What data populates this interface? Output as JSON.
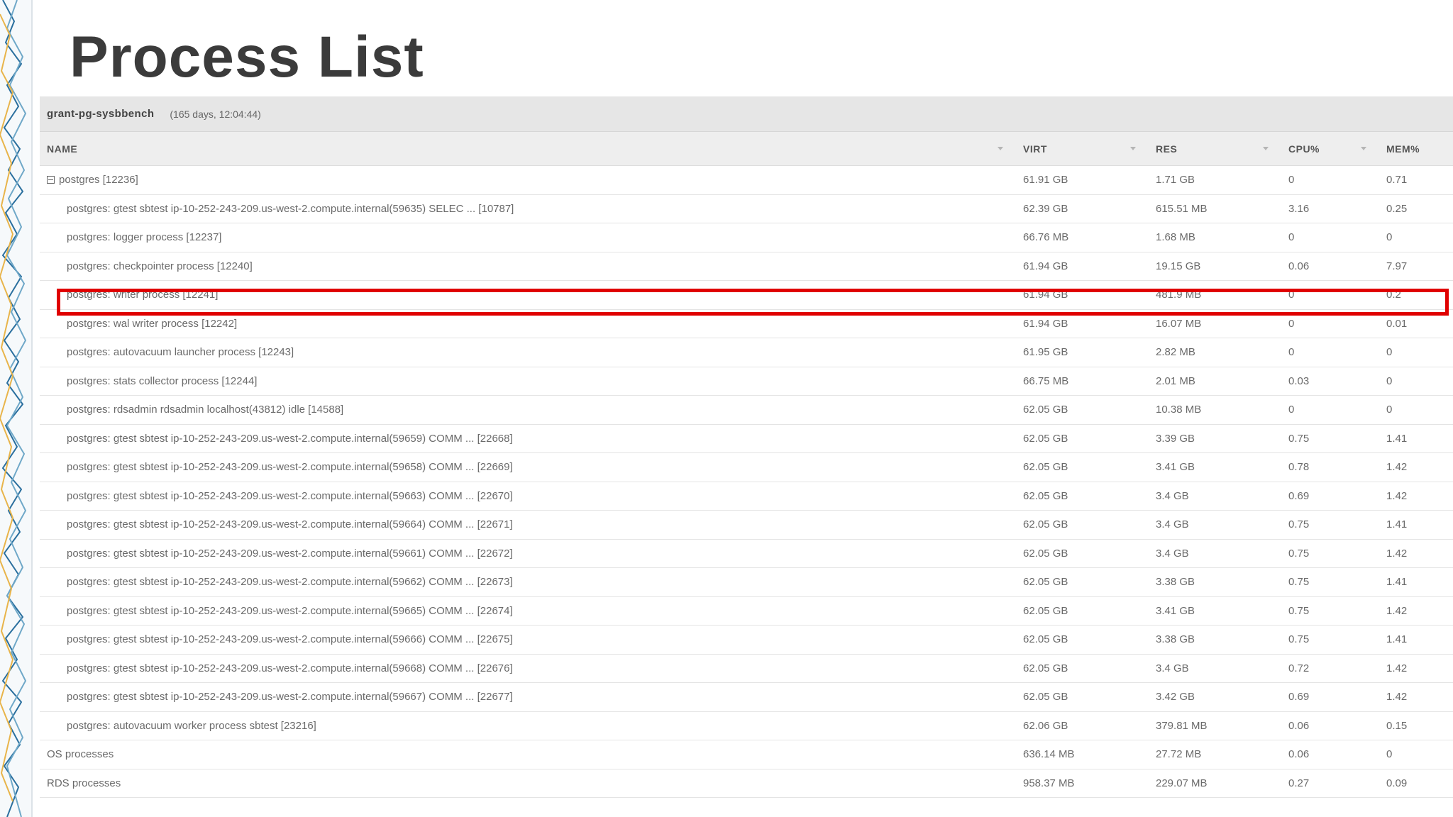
{
  "page": {
    "title": "Process List"
  },
  "server": {
    "name": "grant-pg-sysbbench",
    "uptime": "(165 days, 12:04:44)"
  },
  "columns": {
    "name": "NAME",
    "virt": "VIRT",
    "res": "RES",
    "cpu": "CPU%",
    "mem": "MEM%"
  },
  "rows": [
    {
      "name": "postgres [12236]",
      "virt": "61.91 GB",
      "res": "1.71 GB",
      "cpu": "0",
      "mem": "0.71"
    },
    {
      "name": "postgres: gtest sbtest ip-10-252-243-209.us-west-2.compute.internal(59635) SELEC ... [10787]",
      "virt": "62.39 GB",
      "res": "615.51 MB",
      "cpu": "3.16",
      "mem": "0.25"
    },
    {
      "name": "postgres: logger process [12237]",
      "virt": "66.76 MB",
      "res": "1.68 MB",
      "cpu": "0",
      "mem": "0"
    },
    {
      "name": "postgres: checkpointer process [12240]",
      "virt": "61.94 GB",
      "res": "19.15 GB",
      "cpu": "0.06",
      "mem": "7.97"
    },
    {
      "name": "postgres: writer process [12241]",
      "virt": "61.94 GB",
      "res": "481.9 MB",
      "cpu": "0",
      "mem": "0.2"
    },
    {
      "name": "postgres: wal writer process [12242]",
      "virt": "61.94 GB",
      "res": "16.07 MB",
      "cpu": "0",
      "mem": "0.01"
    },
    {
      "name": "postgres: autovacuum launcher process [12243]",
      "virt": "61.95 GB",
      "res": "2.82 MB",
      "cpu": "0",
      "mem": "0"
    },
    {
      "name": "postgres: stats collector process [12244]",
      "virt": "66.75 MB",
      "res": "2.01 MB",
      "cpu": "0.03",
      "mem": "0"
    },
    {
      "name": "postgres: rdsadmin rdsadmin localhost(43812) idle [14588]",
      "virt": "62.05 GB",
      "res": "10.38 MB",
      "cpu": "0",
      "mem": "0"
    },
    {
      "name": "postgres: gtest sbtest ip-10-252-243-209.us-west-2.compute.internal(59659) COMM ... [22668]",
      "virt": "62.05 GB",
      "res": "3.39 GB",
      "cpu": "0.75",
      "mem": "1.41"
    },
    {
      "name": "postgres: gtest sbtest ip-10-252-243-209.us-west-2.compute.internal(59658) COMM ... [22669]",
      "virt": "62.05 GB",
      "res": "3.41 GB",
      "cpu": "0.78",
      "mem": "1.42"
    },
    {
      "name": "postgres: gtest sbtest ip-10-252-243-209.us-west-2.compute.internal(59663) COMM ... [22670]",
      "virt": "62.05 GB",
      "res": "3.4 GB",
      "cpu": "0.69",
      "mem": "1.42"
    },
    {
      "name": "postgres: gtest sbtest ip-10-252-243-209.us-west-2.compute.internal(59664) COMM ... [22671]",
      "virt": "62.05 GB",
      "res": "3.4 GB",
      "cpu": "0.75",
      "mem": "1.41"
    },
    {
      "name": "postgres: gtest sbtest ip-10-252-243-209.us-west-2.compute.internal(59661) COMM ... [22672]",
      "virt": "62.05 GB",
      "res": "3.4 GB",
      "cpu": "0.75",
      "mem": "1.42"
    },
    {
      "name": "postgres: gtest sbtest ip-10-252-243-209.us-west-2.compute.internal(59662) COMM ... [22673]",
      "virt": "62.05 GB",
      "res": "3.38 GB",
      "cpu": "0.75",
      "mem": "1.41"
    },
    {
      "name": "postgres: gtest sbtest ip-10-252-243-209.us-west-2.compute.internal(59665) COMM ... [22674]",
      "virt": "62.05 GB",
      "res": "3.41 GB",
      "cpu": "0.75",
      "mem": "1.42"
    },
    {
      "name": "postgres: gtest sbtest ip-10-252-243-209.us-west-2.compute.internal(59666) COMM ... [22675]",
      "virt": "62.05 GB",
      "res": "3.38 GB",
      "cpu": "0.75",
      "mem": "1.41"
    },
    {
      "name": "postgres: gtest sbtest ip-10-252-243-209.us-west-2.compute.internal(59668) COMM ... [22676]",
      "virt": "62.05 GB",
      "res": "3.4 GB",
      "cpu": "0.72",
      "mem": "1.42"
    },
    {
      "name": "postgres: gtest sbtest ip-10-252-243-209.us-west-2.compute.internal(59667) COMM ... [22677]",
      "virt": "62.05 GB",
      "res": "3.42 GB",
      "cpu": "0.69",
      "mem": "1.42"
    },
    {
      "name": "postgres: autovacuum worker process sbtest [23216]",
      "virt": "62.06 GB",
      "res": "379.81 MB",
      "cpu": "0.06",
      "mem": "0.15"
    },
    {
      "name": "OS processes",
      "virt": "636.14 MB",
      "res": "27.72 MB",
      "cpu": "0.06",
      "mem": "0"
    },
    {
      "name": "RDS processes",
      "virt": "958.37 MB",
      "res": "229.07 MB",
      "cpu": "0.27",
      "mem": "0.09"
    }
  ],
  "colors": {
    "highlight": "#e00000"
  },
  "icons": {
    "collapse": "collapse-minus-icon",
    "sort": "sort-arrow-icon"
  }
}
